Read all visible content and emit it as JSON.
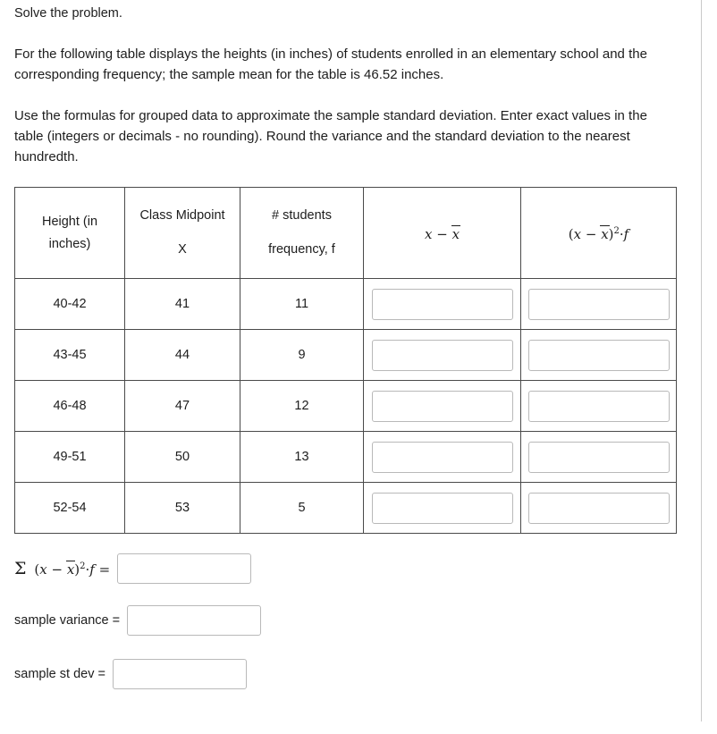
{
  "instruction": "Solve the problem.",
  "paragraphs": [
    "For the following table displays the heights (in inches) of students enrolled in an elementary school and the corresponding frequency; the sample mean for the table is 46.52 inches.",
    "Use the formulas for grouped data  to approximate the sample standard deviation. Enter exact values in the table  (integers or decimals - no rounding). Round the variance and the standard deviation to the nearest hundredth."
  ],
  "table": {
    "headers": {
      "col1_line1": "Height (in",
      "col1_line2": "inches)",
      "col2_line1": "Class Midpoint",
      "col2_line2": "X",
      "col3_line1": "# students",
      "col3_line2": "frequency, f",
      "col4_prefix": "x",
      "col4_minus": "−",
      "col4_overline": "x",
      "col5_text": "(x − x)² ·f"
    },
    "rows": [
      {
        "height": "40-42",
        "midpoint": "41",
        "frequency": "11",
        "dev_value": "",
        "devsqf_value": ""
      },
      {
        "height": "43-45",
        "midpoint": "44",
        "frequency": "9",
        "dev_value": "",
        "devsqf_value": ""
      },
      {
        "height": "46-48",
        "midpoint": "47",
        "frequency": "12",
        "dev_value": "",
        "devsqf_value": ""
      },
      {
        "height": "49-51",
        "midpoint": "50",
        "frequency": "13",
        "dev_value": "",
        "devsqf_value": ""
      },
      {
        "height": "52-54",
        "midpoint": "53",
        "frequency": "5",
        "dev_value": "",
        "devsqf_value": ""
      }
    ]
  },
  "answers": {
    "sum_label_sigma": "Σ",
    "sum_label_rest": "(x − x)² ·f =",
    "sum_value": "",
    "variance_label": "sample variance =",
    "variance_value": "",
    "stdev_label": "sample st dev =",
    "stdev_value": ""
  },
  "colors": {
    "table_border": "#4a4a4a",
    "input_border": "#b9b9b9",
    "text": "#1d1d1d",
    "rule": "#c9c9c9"
  }
}
